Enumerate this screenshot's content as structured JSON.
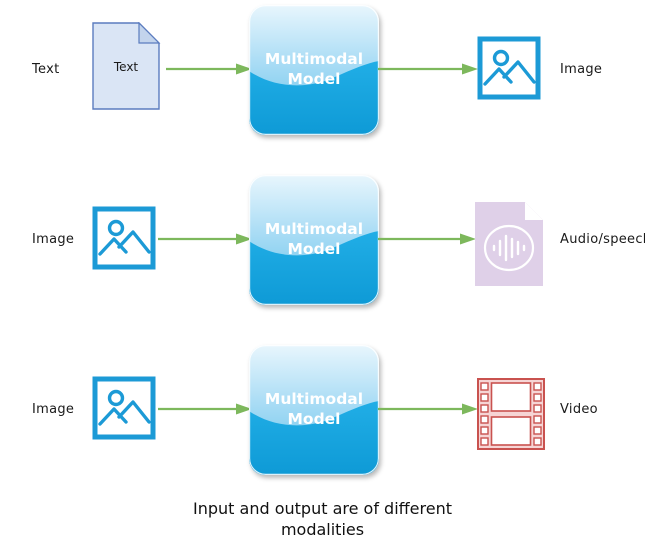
{
  "diagram": {
    "caption_line1": "Input and output are of different",
    "caption_line2": "modalities",
    "model_label_line1": "Multimodal",
    "model_label_line2": "Model",
    "colors": {
      "model_blue": "#1CA3E0",
      "model_blue_light": "#D9EFFB",
      "arrow_green": "#7DB85C",
      "image_icon_blue": "#1C9AD6",
      "doc_fill": "#DAE5F5",
      "doc_stroke": "#5B7CBF",
      "audio_fill": "#DFD0E8",
      "video_fill": "#F6D5D5",
      "video_stroke": "#C9524F",
      "text_color": "#1a1a1a"
    },
    "rows": [
      {
        "input_label": "Text",
        "input_icon": "text-document-icon",
        "input_icon_caption": "Text",
        "output_label": "Image",
        "output_icon": "picture-icon"
      },
      {
        "input_label": "Image",
        "input_icon": "picture-icon",
        "input_icon_caption": "",
        "output_label": "Audio/speech",
        "output_icon": "audio-waveform-document-icon"
      },
      {
        "input_label": "Image",
        "input_icon": "picture-icon",
        "input_icon_caption": "",
        "output_label": "Video",
        "output_icon": "film-strip-icon"
      }
    ]
  }
}
